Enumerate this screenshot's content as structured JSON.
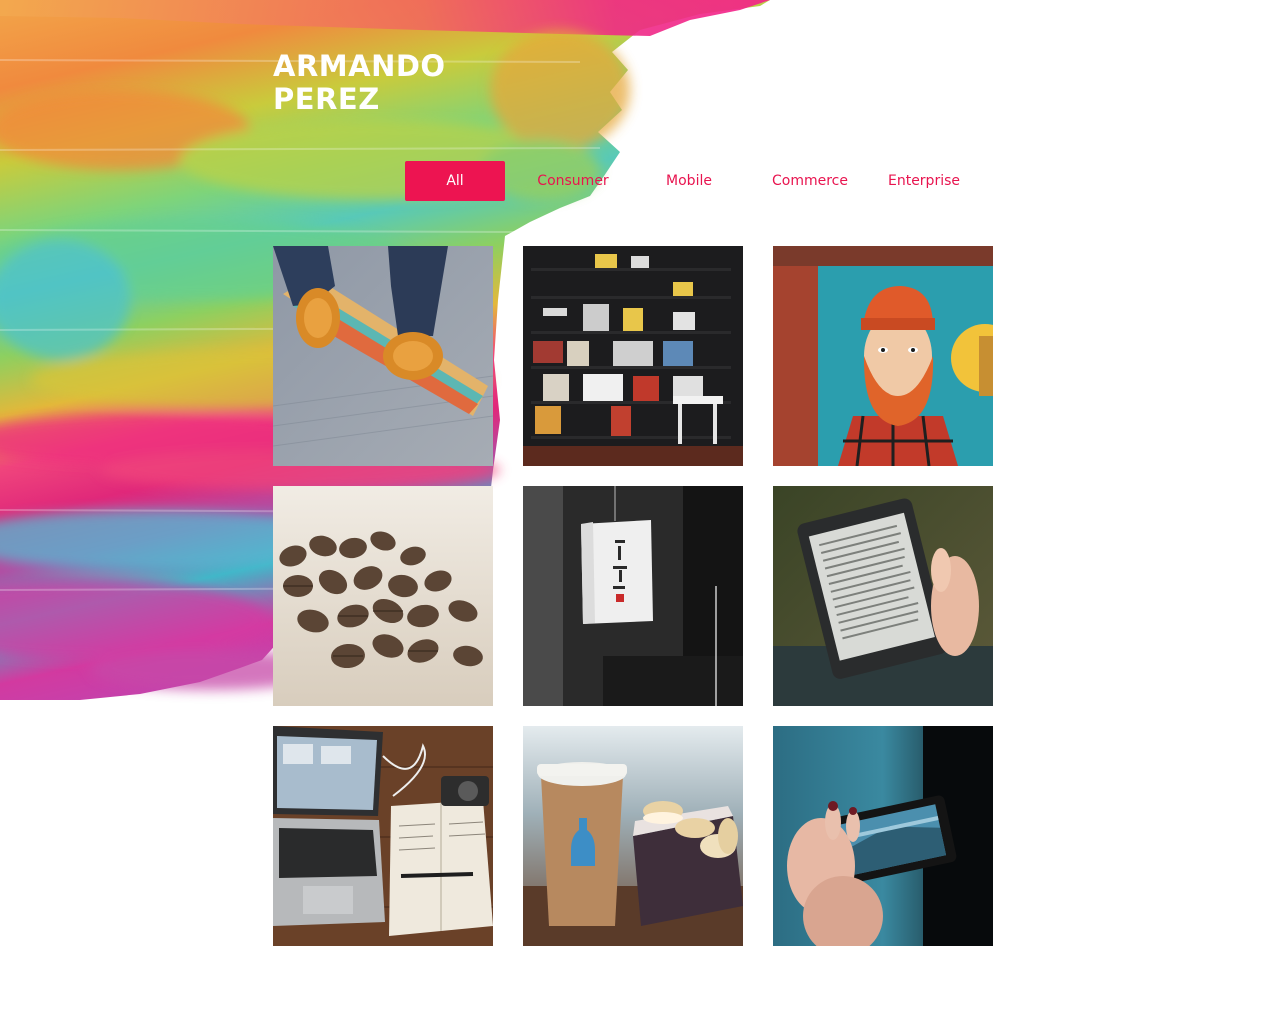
{
  "header": {
    "title_line1": "ARMANDO",
    "title_line2": "PEREZ"
  },
  "filters": {
    "active": "All",
    "items": [
      {
        "label": "All"
      },
      {
        "label": "Consumer"
      },
      {
        "label": "Mobile"
      },
      {
        "label": "Commerce"
      },
      {
        "label": "Enterprise"
      }
    ]
  },
  "gallery": {
    "items": [
      {
        "subject": "skateboard-shoes"
      },
      {
        "subject": "bookshelf"
      },
      {
        "subject": "bearded-man-mural"
      },
      {
        "subject": "coffee-beans"
      },
      {
        "subject": "paper-lantern"
      },
      {
        "subject": "ereader-kindle"
      },
      {
        "subject": "laptop-notebook"
      },
      {
        "subject": "coffee-cup-macarons"
      },
      {
        "subject": "phone-camera-photo"
      }
    ]
  },
  "colors": {
    "accent": "#ed1451",
    "accent_text": "#e8144f",
    "title": "#ffffff",
    "background": "#ffffff"
  }
}
